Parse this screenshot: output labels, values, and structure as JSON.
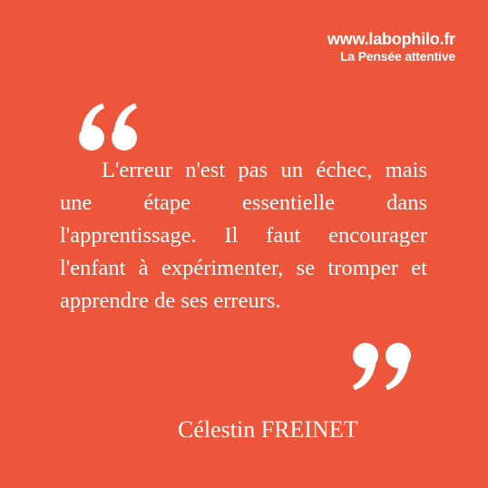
{
  "brand": {
    "url": "www.labophilo.fr",
    "tagline": "La Pensée attentive"
  },
  "quote": {
    "text": "L'erreur n'est pas un échec, mais une étape essentielle dans l'apprentissage. Il faut encourager l'enfant à expérimenter, se tromper et apprendre de ses erreurs.",
    "author": "Célestin FREINET"
  },
  "icons": {
    "open_quote": "open-quote-icon",
    "close_quote": "close-quote-icon"
  },
  "colors": {
    "background": "#EE563B",
    "text": "#FFFFFF"
  }
}
